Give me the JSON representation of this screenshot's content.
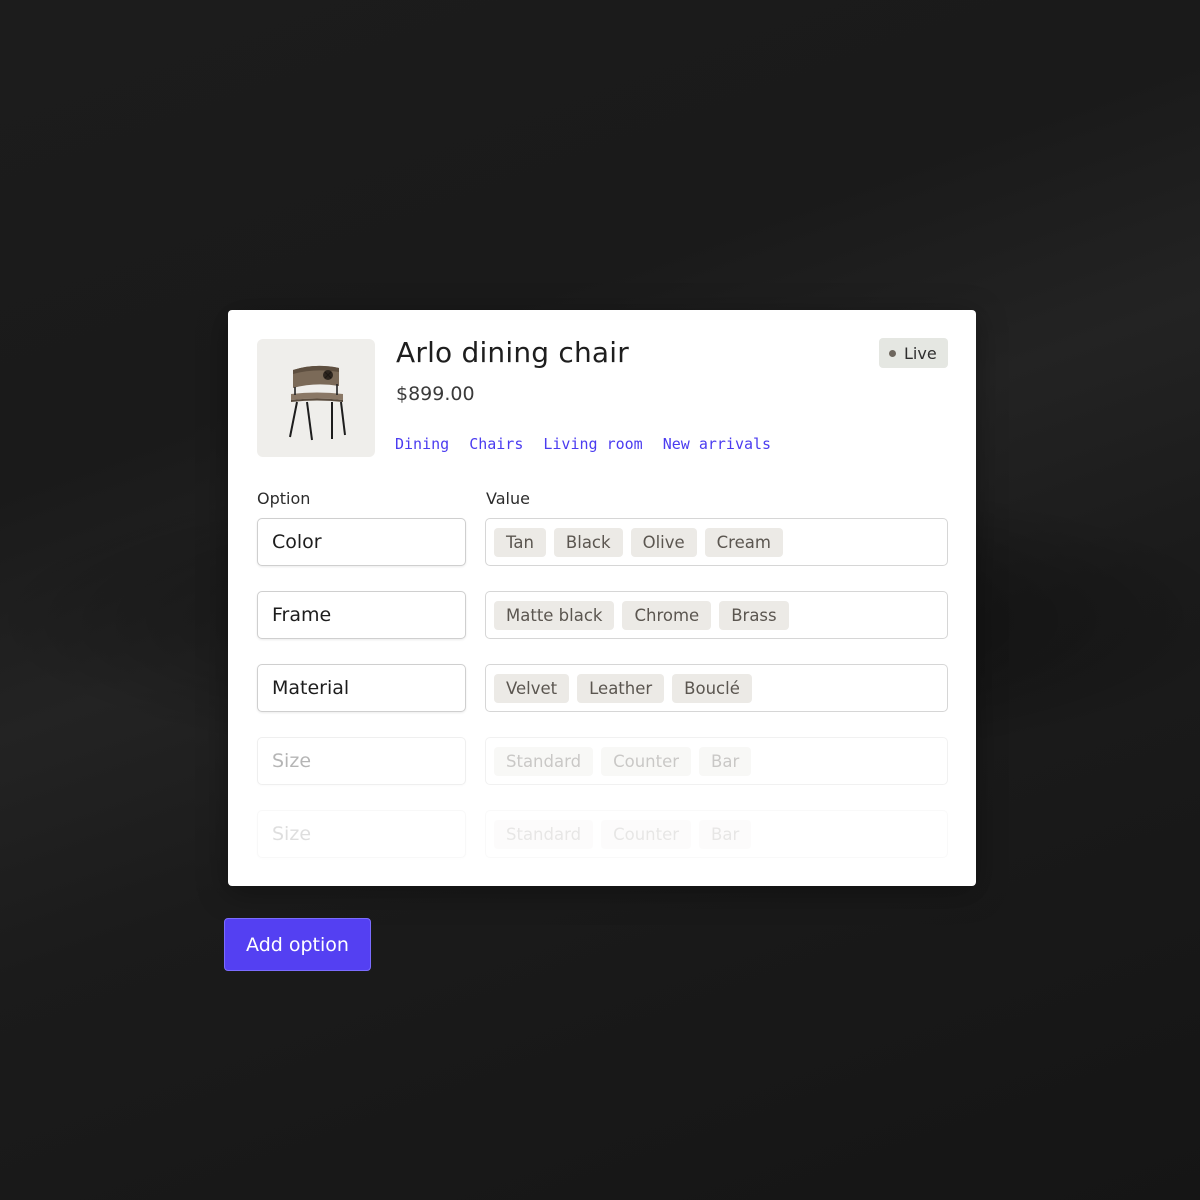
{
  "product": {
    "title": "Arlo dining chair",
    "price": "$899.00",
    "status": "Live",
    "image_icon": "chair-image",
    "collections": [
      "Dining",
      "Chairs",
      "Living room",
      "New arrivals"
    ]
  },
  "columns": {
    "option": "Option",
    "value": "Value"
  },
  "options": [
    {
      "name": "Color",
      "values": [
        "Tan",
        "Black",
        "Olive",
        "Cream"
      ]
    },
    {
      "name": "Frame",
      "values": [
        "Matte black",
        "Chrome",
        "Brass"
      ]
    },
    {
      "name": "Material",
      "values": [
        "Velvet",
        "Leather",
        "Bouclé"
      ]
    },
    {
      "name": "Size",
      "values": [
        "Standard",
        "Counter",
        "Bar"
      ]
    },
    {
      "name": "Size",
      "values": [
        "Standard",
        "Counter",
        "Bar"
      ]
    }
  ],
  "actions": {
    "add_option": "Add option"
  },
  "colors": {
    "accent": "#5440f2",
    "link": "#4b3cf0",
    "badge_bg": "#e5e7e2",
    "chip_bg": "#eceae6"
  }
}
